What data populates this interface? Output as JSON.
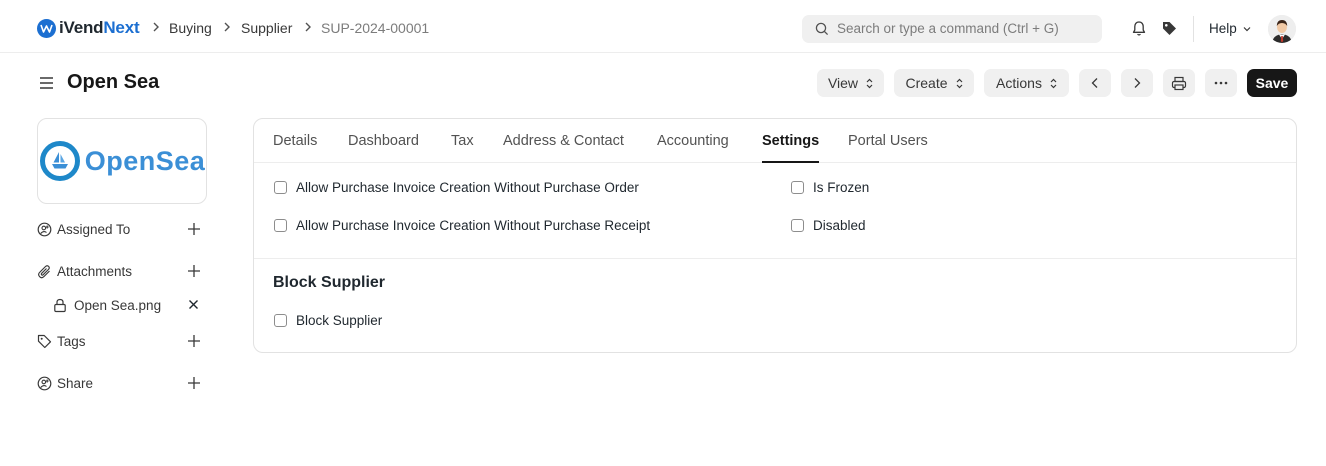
{
  "navbar": {
    "brand_a": "iVend",
    "brand_b": "Next",
    "breadcrumbs": [
      "Buying",
      "Supplier",
      "SUP-2024-00001"
    ],
    "search_placeholder": "Search or type a command (Ctrl + G)",
    "help_label": "Help"
  },
  "page": {
    "title": "Open Sea",
    "buttons": {
      "view": "View",
      "create": "Create",
      "actions": "Actions",
      "save": "Save"
    }
  },
  "sidebar": {
    "logo_text": "OpenSea",
    "assigned_to": "Assigned To",
    "attachments": "Attachments",
    "attachment_file": "Open Sea.png",
    "tags": "Tags",
    "share": "Share"
  },
  "tabs": [
    "Details",
    "Dashboard",
    "Tax",
    "Address & Contact",
    "Accounting",
    "Settings",
    "Portal Users"
  ],
  "active_tab": "Settings",
  "settings": {
    "left_checks": [
      {
        "label": "Allow Purchase Invoice Creation Without Purchase Order",
        "checked": false
      },
      {
        "label": "Allow Purchase Invoice Creation Without Purchase Receipt",
        "checked": false
      }
    ],
    "right_checks": [
      {
        "label": "Is Frozen",
        "checked": false
      },
      {
        "label": "Disabled",
        "checked": false
      }
    ],
    "block_section_title": "Block Supplier",
    "block_check": {
      "label": "Block Supplier",
      "checked": false
    }
  },
  "colors": {
    "brand_blue": "#1c6fd1",
    "logo_blue": "#3b8fd6",
    "save_bg": "#171717"
  }
}
